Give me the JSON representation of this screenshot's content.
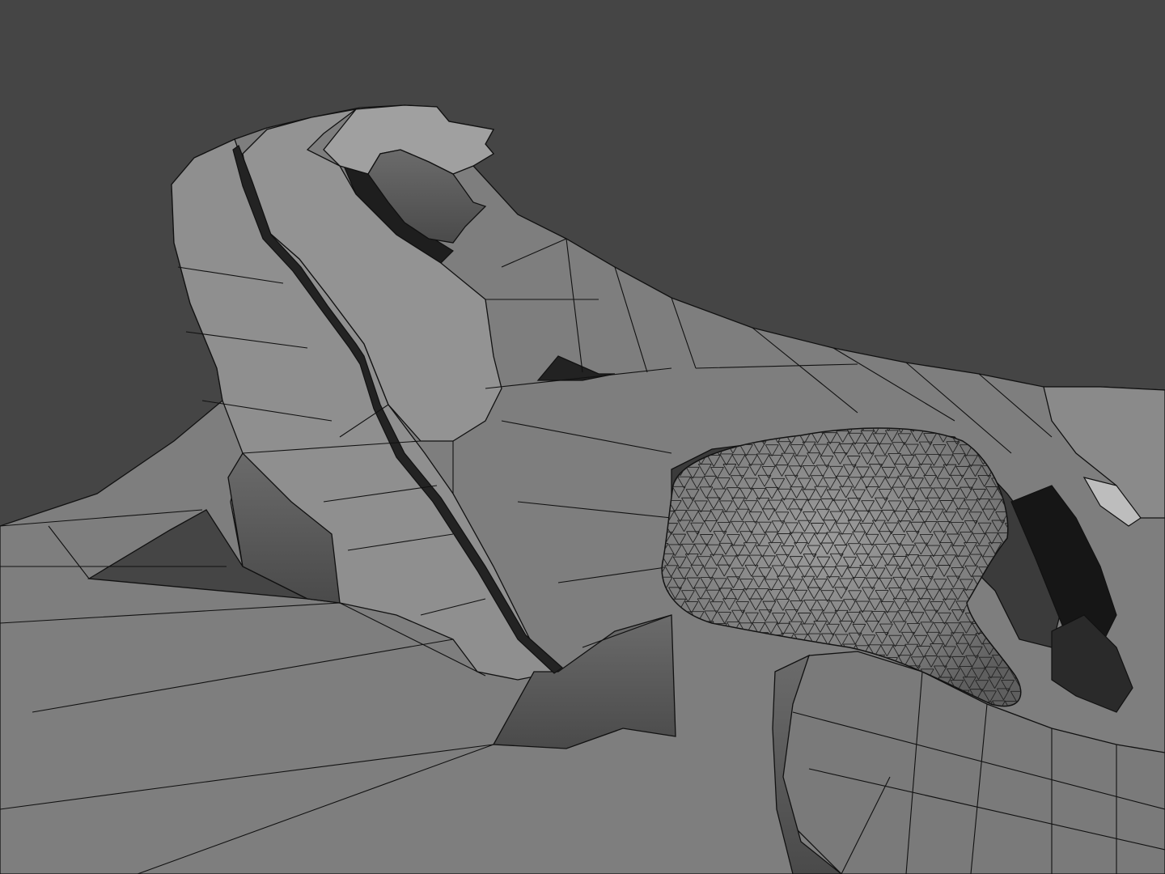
{
  "scene": {
    "background_color": "#454545",
    "surface_color": "#7e7e7e",
    "surface_light_color": "#939393",
    "surface_dark_color": "#5b5b5b",
    "shadow_color": "#1b1b1b",
    "wire_color": "#111111",
    "shading": "gray-shaded-with-wireframe",
    "objects": [
      "low-poly-mesh",
      "high-poly-sculpt-blob"
    ]
  }
}
